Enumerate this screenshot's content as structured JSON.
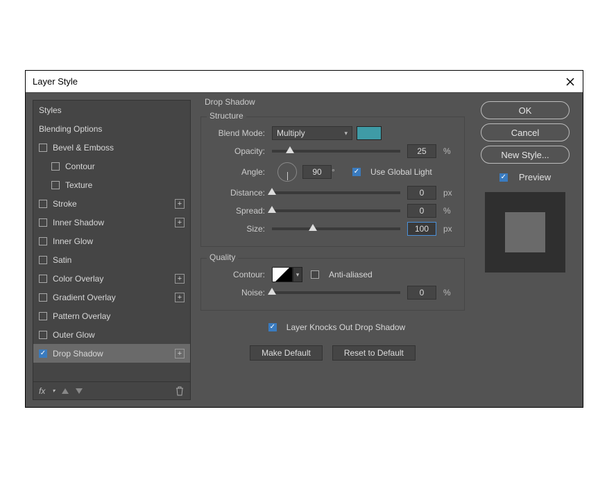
{
  "dialog": {
    "title": "Layer Style"
  },
  "sidebar": {
    "styles": "Styles",
    "blending": "Blending Options",
    "items": [
      {
        "label": "Bevel & Emboss",
        "checked": false,
        "plus": false,
        "indent": 0
      },
      {
        "label": "Contour",
        "checked": false,
        "plus": false,
        "indent": 1
      },
      {
        "label": "Texture",
        "checked": false,
        "plus": false,
        "indent": 1
      },
      {
        "label": "Stroke",
        "checked": false,
        "plus": true,
        "indent": 0
      },
      {
        "label": "Inner Shadow",
        "checked": false,
        "plus": true,
        "indent": 0
      },
      {
        "label": "Inner Glow",
        "checked": false,
        "plus": false,
        "indent": 0
      },
      {
        "label": "Satin",
        "checked": false,
        "plus": false,
        "indent": 0
      },
      {
        "label": "Color Overlay",
        "checked": false,
        "plus": true,
        "indent": 0
      },
      {
        "label": "Gradient Overlay",
        "checked": false,
        "plus": true,
        "indent": 0
      },
      {
        "label": "Pattern Overlay",
        "checked": false,
        "plus": false,
        "indent": 0
      },
      {
        "label": "Outer Glow",
        "checked": false,
        "plus": false,
        "indent": 0
      },
      {
        "label": "Drop Shadow",
        "checked": true,
        "plus": true,
        "indent": 0,
        "selected": true
      }
    ],
    "fx": "fx"
  },
  "panel": {
    "title": "Drop Shadow",
    "structure_label": "Structure",
    "blend_mode_label": "Blend Mode:",
    "blend_mode_value": "Multiply",
    "color": "#3f9ba6",
    "opacity_label": "Opacity:",
    "opacity_value": "25",
    "percent": "%",
    "angle_label": "Angle:",
    "angle_value": "90",
    "degree": "°",
    "use_global_light": "Use Global Light",
    "use_global_light_checked": true,
    "distance_label": "Distance:",
    "distance_value": "0",
    "spread_label": "Spread:",
    "spread_value": "0",
    "size_label": "Size:",
    "size_value": "100",
    "px": "px",
    "quality_label": "Quality",
    "contour_label": "Contour:",
    "anti_aliased": "Anti-aliased",
    "anti_aliased_checked": false,
    "noise_label": "Noise:",
    "noise_value": "0",
    "knockout_label": "Layer Knocks Out Drop Shadow",
    "knockout_checked": true,
    "make_default": "Make Default",
    "reset_default": "Reset to Default"
  },
  "buttons": {
    "ok": "OK",
    "cancel": "Cancel",
    "new_style": "New Style...",
    "preview": "Preview",
    "preview_checked": true
  },
  "slider_positions": {
    "opacity": 14,
    "distance": 0,
    "spread": 0,
    "size": 32,
    "noise": 0
  }
}
